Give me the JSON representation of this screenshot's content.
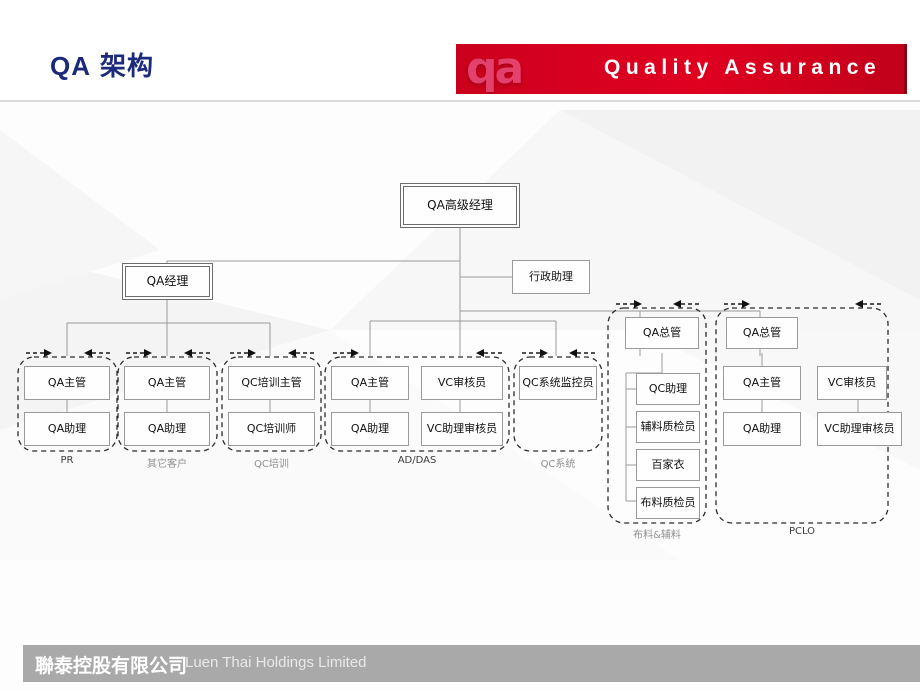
{
  "slide": {
    "title_en": "QA",
    "title_cn": "架构",
    "banner": {
      "logo_text": "qa",
      "label": "Quality Assurance",
      "bg_color": "#d4001f"
    },
    "title_color": "#1b2a7a"
  },
  "footer": {
    "company_cn": "聯泰控股有限公司",
    "company_en": "Luen Thai Holdings Limited",
    "bar_color": "#a9a9a9"
  },
  "chart_data": {
    "type": "diagram",
    "title": "QA 架构",
    "nodes": {
      "senior_manager": "QA高级经理",
      "admin_assistant": "行政助理",
      "manager": "QA经理"
    },
    "groups": [
      {
        "label": "PR",
        "label_faded": false,
        "boxes": [
          "QA主管",
          "QA助理"
        ]
      },
      {
        "label": "其它客户",
        "label_faded": true,
        "boxes": [
          "QA主管",
          "QA助理"
        ]
      },
      {
        "label": "QC培训",
        "label_faded": true,
        "boxes": [
          "QC培训主管",
          "QC培训师"
        ]
      },
      {
        "label": "AD/DAS",
        "label_faded": false,
        "boxes": [
          "QA主管",
          "VC审核员",
          "QA助理",
          "VC助理审核员"
        ]
      },
      {
        "label": "QC系统",
        "label_faded": true,
        "boxes": [
          "QC系统监控员"
        ]
      },
      {
        "label": "布料&辅料",
        "label_faded": true,
        "boxes": [
          "QA总管",
          "QC助理",
          "辅料质检员",
          "百家衣",
          "布料质检员"
        ]
      },
      {
        "label": "PCLO",
        "label_faded": false,
        "boxes": [
          "QA总管",
          "QA主管",
          "VC审核员",
          "QA助理",
          "VC助理审核员"
        ]
      }
    ]
  }
}
